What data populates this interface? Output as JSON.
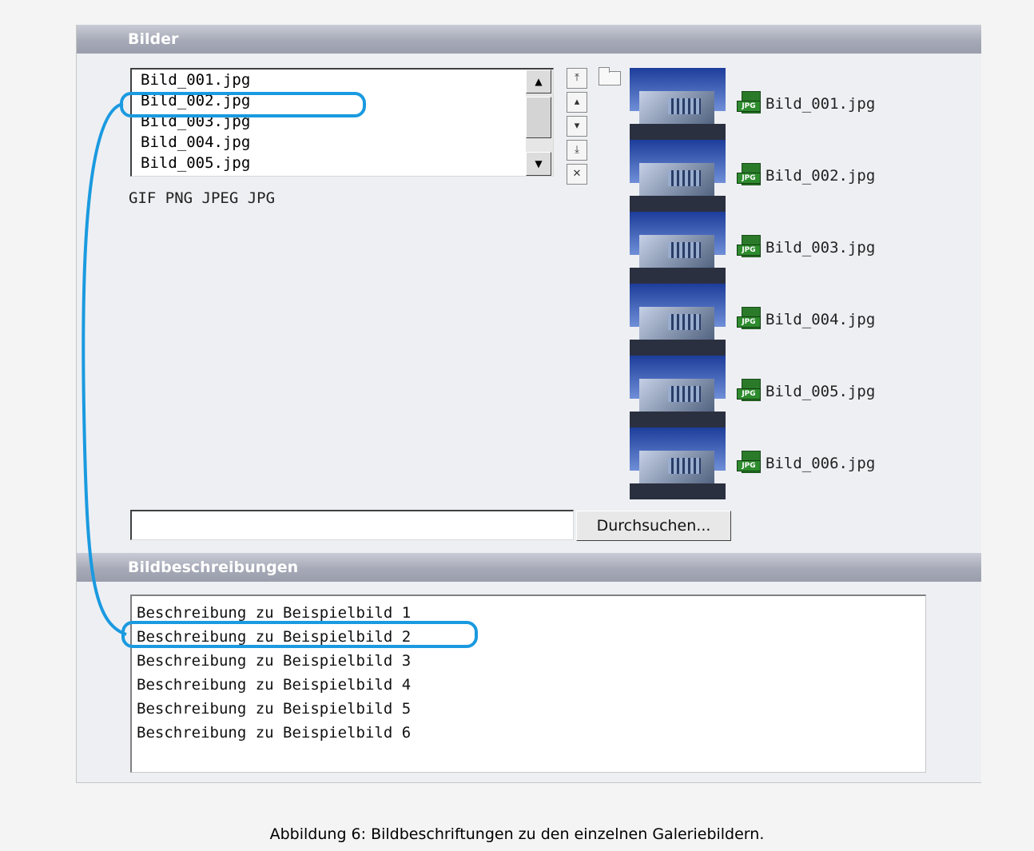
{
  "sections": {
    "bilder": {
      "title": "Bilder"
    },
    "beschreibungen": {
      "title": "Bildbeschreibungen"
    }
  },
  "file_list": {
    "items": [
      "Bild_001.jpg",
      "Bild_002.jpg",
      "Bild_003.jpg",
      "Bild_004.jpg",
      "Bild_005.jpg"
    ],
    "highlighted": "Bild_002.jpg"
  },
  "allowed_formats": "GIF PNG JPEG JPG",
  "controls": [
    "move-to-top",
    "move-up",
    "move-down",
    "move-to-bottom",
    "remove"
  ],
  "thumbnails": [
    {
      "filename": "Bild_001.jpg",
      "icon": "jpg-file-icon"
    },
    {
      "filename": "Bild_002.jpg",
      "icon": "jpg-file-icon"
    },
    {
      "filename": "Bild_003.jpg",
      "icon": "jpg-file-icon"
    },
    {
      "filename": "Bild_004.jpg",
      "icon": "jpg-file-icon"
    },
    {
      "filename": "Bild_005.jpg",
      "icon": "jpg-file-icon"
    },
    {
      "filename": "Bild_006.jpg",
      "icon": "jpg-file-icon"
    }
  ],
  "jpg_badge": "JPG",
  "upload": {
    "value": "",
    "browse_label": "Durchsuchen..."
  },
  "descriptions": [
    "Beschreibung zu Beispielbild 1",
    "Beschreibung zu Beispielbild 2",
    "Beschreibung zu Beispielbild 3",
    "Beschreibung zu Beispielbild 4",
    "Beschreibung zu Beispielbild 5",
    "Beschreibung zu Beispielbild 6"
  ],
  "highlight_color": "#1a9ae0",
  "caption": "Abbildung 6: Bildbeschriftungen zu den einzelnen Galeriebildern."
}
